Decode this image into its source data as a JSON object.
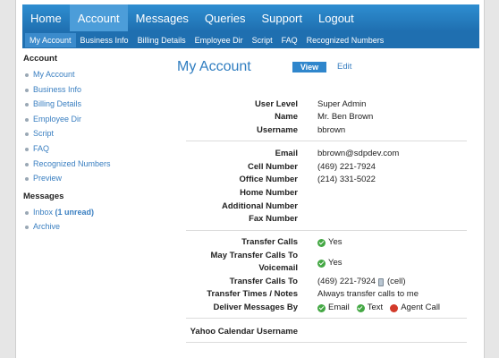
{
  "nav": {
    "tabs": [
      {
        "label": "Home"
      },
      {
        "label": "Account"
      },
      {
        "label": "Messages"
      },
      {
        "label": "Queries"
      },
      {
        "label": "Support"
      },
      {
        "label": "Logout"
      }
    ],
    "active_tab": "Account",
    "subtabs": [
      {
        "label": "My Account"
      },
      {
        "label": "Business Info"
      },
      {
        "label": "Billing Details"
      },
      {
        "label": "Employee Dir"
      },
      {
        "label": "Script"
      },
      {
        "label": "FAQ"
      },
      {
        "label": "Recognized Numbers"
      }
    ]
  },
  "sidebar": {
    "account_heading": "Account",
    "account_items": [
      {
        "label": "My Account"
      },
      {
        "label": "Business Info"
      },
      {
        "label": "Billing Details"
      },
      {
        "label": "Employee Dir"
      },
      {
        "label": "Script"
      },
      {
        "label": "FAQ"
      },
      {
        "label": "Recognized Numbers"
      },
      {
        "label": "Preview"
      }
    ],
    "messages_heading": "Messages",
    "inbox_label": "Inbox",
    "inbox_unread": "(1 unread)",
    "archive_label": "Archive"
  },
  "main": {
    "title": "My Account",
    "view_label": "View",
    "edit_label": "Edit",
    "fields": {
      "user_level": {
        "label": "User Level",
        "value": "Super Admin"
      },
      "name": {
        "label": "Name",
        "value": "Mr. Ben Brown"
      },
      "username": {
        "label": "Username",
        "value": "bbrown"
      },
      "email": {
        "label": "Email",
        "value": "bbrown@sdpdev.com"
      },
      "cell": {
        "label": "Cell Number",
        "value": "(469) 221-7924"
      },
      "office": {
        "label": "Office Number",
        "value": "(214) 331-5022"
      },
      "home": {
        "label": "Home Number",
        "value": ""
      },
      "additional": {
        "label": "Additional Number",
        "value": ""
      },
      "fax": {
        "label": "Fax Number",
        "value": ""
      },
      "transfer_calls": {
        "label": "Transfer Calls",
        "value": "Yes"
      },
      "may_transfer_1": {
        "label": "May Transfer Calls To",
        "value": "Yes"
      },
      "may_transfer_2": {
        "label": "Voicemail"
      },
      "transfer_to": {
        "label": "Transfer Calls To",
        "value": "(469) 221-7924",
        "suffix": "(cell)"
      },
      "transfer_times": {
        "label": "Transfer Times / Notes",
        "value": "Always transfer calls to me"
      },
      "deliver": {
        "label": "Deliver Messages By",
        "email": "Email",
        "text": "Text",
        "agent": "Agent Call"
      },
      "yahoo": {
        "label": "Yahoo Calendar Username",
        "value": ""
      }
    }
  },
  "colors": {
    "nav_blue": "#1f6fb0",
    "link_blue": "#3a7fc1",
    "check_green": "#44a844",
    "agent_red": "#d23a2a"
  }
}
